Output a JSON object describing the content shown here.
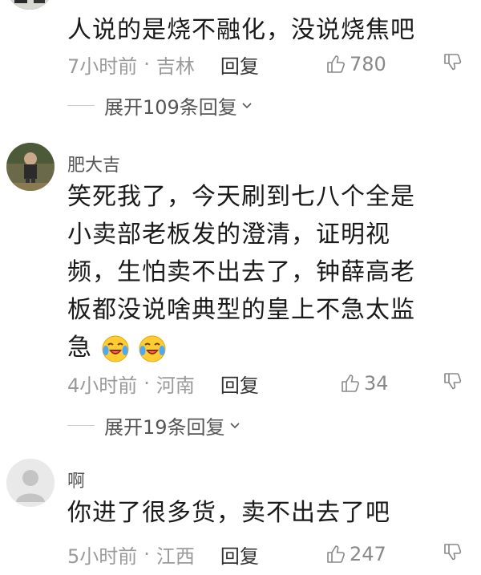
{
  "comments": [
    {
      "content": "人说的是烧不融化，没说烧焦吧",
      "time": "7小时前",
      "location": "吉林",
      "reply_label": "回复",
      "likes": "780",
      "expand_label": "展开109条回复"
    },
    {
      "username": "肥大吉",
      "content_lines": [
        "笑死我了，今天刷到七八个全是",
        "小卖部老板发的澄清，证明视",
        "频，生怕卖不出去了，钟薛高老",
        "板都没说啥典型的皇上不急太监",
        "急"
      ],
      "emoji": "crying-laughing-emoji",
      "time": "4小时前",
      "location": "河南",
      "reply_label": "回复",
      "likes": "34",
      "expand_label": "展开19条回复"
    },
    {
      "username": "啊",
      "content": "你进了很多货，卖不出去了吧",
      "time": "5小时前",
      "location": "江西",
      "reply_label": "回复",
      "likes": "247"
    }
  ],
  "separator": "·",
  "icons": {
    "like": "thumbs-up-icon",
    "dislike": "thumbs-down-icon",
    "expand": "chevron-down-icon",
    "default_avatar": "default-avatar-icon"
  }
}
